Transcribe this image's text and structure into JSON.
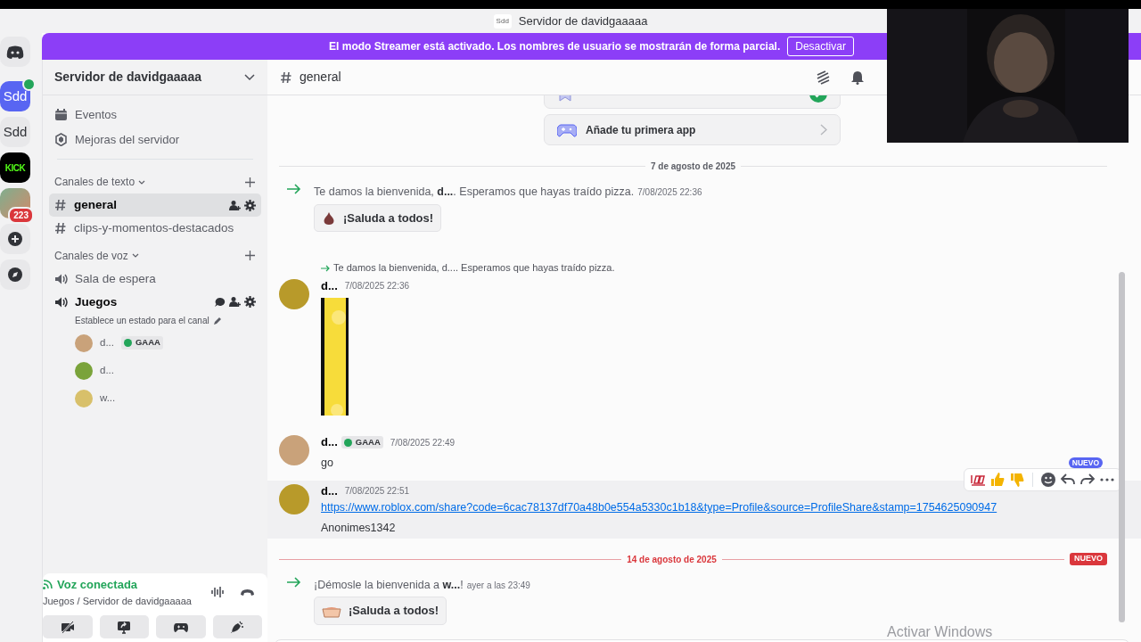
{
  "title_bar": {
    "icon_text": "Sdd",
    "title": "Servidor de davidgaaaaa"
  },
  "banner": {
    "text": "El modo Streamer está activado. Los nombres de usuario se mostrarán de forma parcial.",
    "button": "Desactivar"
  },
  "servers": [
    {
      "kind": "home"
    },
    {
      "kind": "server",
      "label": "Sdd",
      "selected": true,
      "speaking": true
    },
    {
      "kind": "server",
      "label": "Sdd",
      "selected": false,
      "speaking": false
    },
    {
      "kind": "kick",
      "label": "KICK",
      "selected": false
    },
    {
      "kind": "avatar",
      "badge": "223",
      "selected": false
    },
    {
      "kind": "add"
    },
    {
      "kind": "discover"
    }
  ],
  "server_name": "Servidor de davidgaaaaa",
  "nav_items": [
    {
      "kind": "events",
      "label": "Eventos"
    },
    {
      "kind": "boosts",
      "label": "Mejoras del servidor"
    }
  ],
  "categories": [
    {
      "name": "Canales de texto",
      "kind": "text",
      "channels": [
        {
          "name": "general",
          "selected": true
        },
        {
          "name": "clips-y-momentos-destacados",
          "selected": false
        }
      ]
    },
    {
      "name": "Canales de voz",
      "kind": "voice",
      "channels": [
        {
          "name": "Sala de espera",
          "selected": false,
          "active": false
        },
        {
          "name": "Juegos",
          "selected": false,
          "active": true,
          "status": "Establece un estado para el canal",
          "users": [
            {
              "name": "d...",
              "tag": "GAAA"
            },
            {
              "name": "d..."
            },
            {
              "name": "w..."
            }
          ]
        }
      ]
    }
  ],
  "voice_panel": {
    "status": "Voz conectada",
    "location": "Juegos / Servidor de davidgaaaaa"
  },
  "channel_name": "general",
  "onboarding": [
    {
      "done": true,
      "kind": "message"
    },
    {
      "label": "Añade tu primera app",
      "done": false,
      "kind": "app"
    }
  ],
  "messages": [
    {
      "kind": "divider",
      "label": "7 de agosto de 2025",
      "new": false
    },
    {
      "kind": "join",
      "text": "Te damos la bienvenida, **d...**. Esperamos que hayas traído pizza.",
      "time": "7/08/2025 22:36",
      "sticker": "¡Saluda a todos!"
    },
    {
      "kind": "message",
      "reply": "Te damos la bienvenida, d.... Esperamos que hayas traído pizza.",
      "author": "d...",
      "time": "7/08/2025 22:36",
      "image": true
    },
    {
      "kind": "message",
      "author": "d...",
      "tag": "GAAA",
      "time": "7/08/2025 22:49",
      "text": "go"
    },
    {
      "kind": "message",
      "author": "d...",
      "time": "7/08/2025 22:51",
      "link": "https://www.roblox.com/share?code=6cac78137df70a48b0e554a5330c1b18&type=Profile&source=ProfileShare&stamp=1754625090947",
      "text": "Anonimes1342",
      "hovered": true
    },
    {
      "kind": "divider",
      "label": "14 de agosto de 2025",
      "new": true,
      "new_label": "NUEVO"
    },
    {
      "kind": "join",
      "text": "¡Démosle la bienvenida a **w...**!",
      "time": "ayer a las 23:49",
      "sticker": "¡Saluda a todos!"
    }
  ],
  "hover_toolbar": {
    "new_label": "NUEVO"
  },
  "watermark_os": "Activar Windows"
}
